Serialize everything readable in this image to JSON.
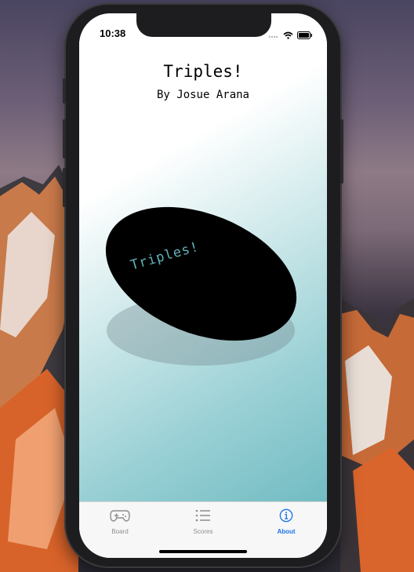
{
  "status_bar": {
    "time": "10:38"
  },
  "header": {
    "title": "Triples!",
    "subtitle": "By Josue Arana"
  },
  "disc": {
    "label": "Triples!"
  },
  "tabbar": {
    "items": [
      {
        "label": "Board",
        "icon": "gamepad-icon",
        "active": false
      },
      {
        "label": "Scores",
        "icon": "list-icon",
        "active": false
      },
      {
        "label": "About",
        "icon": "info-icon",
        "active": true
      }
    ],
    "active_color": "#1a73e8",
    "inactive_color": "#8e8e93"
  },
  "colors": {
    "disc_label": "#5fb2b8",
    "gradient_end": "#72bcc2"
  }
}
